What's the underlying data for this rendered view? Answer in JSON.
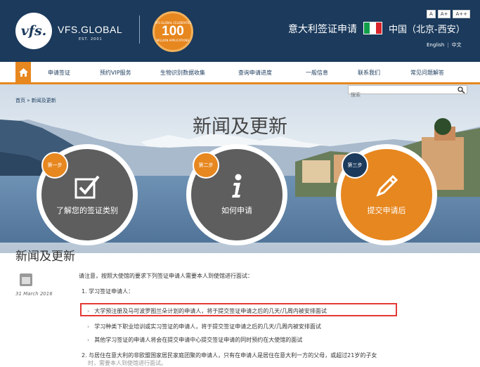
{
  "header": {
    "logo_text": "vfs.",
    "brand": "VFS.GLOBAL",
    "brand_sub": "EST. 2001",
    "badge_top": "VFS GLOBAL CELEBRATES",
    "badge_number": "100",
    "badge_bottom": "MILLION APPLICATIONS",
    "font_sizes": [
      "A",
      "A+",
      "A++"
    ],
    "site_title": "意大利签证申请",
    "flag_colors": [
      "#119e4a",
      "#ffffff",
      "#d9242b"
    ],
    "city": "中国（北京-西安）",
    "lang_en": "English",
    "lang_zh": "中文"
  },
  "nav": {
    "items": [
      "申请签证",
      "预约VIP服务",
      "生物识别数据收集",
      "查询申请进度",
      "一般信息",
      "联系我们",
      "常见问题解答"
    ]
  },
  "hero": {
    "breadcrumb": "首页 » 新闻及更新",
    "search_placeholder": "搜索",
    "title": "新闻及更新",
    "steps": [
      {
        "badge": "第一步",
        "label": "了解您的签证类别",
        "icon": "checkbox-icon"
      },
      {
        "badge": "第二步",
        "label": "如何申请",
        "icon": "info-icon"
      },
      {
        "badge": "第三步",
        "label": "提交申请后",
        "icon": "pencil-icon"
      }
    ]
  },
  "news": {
    "title": "新闻及更新",
    "date": "31 March 2016",
    "notice": "请注意，按照大使馆的要求下列签证申请人需要本人到使馆进行面试：",
    "item1": "1.  学习签证申请人：",
    "subitems": [
      "大学预注册及马可波罗图兰朵计划的申请人，将于提交签证申请之后的几天/几周内被安排面试",
      "学习种类下职业培训或实习签证的申请人，将于提交签证申请之后的几天/几周内被安排面试",
      "其他学习签证的申请人将会在提交申请中心提交签证申请的同时预约在大使馆的面试"
    ],
    "item2": "2.  与居住在意大利的非欧盟国家居民家庭团聚的申请人，只有在申请人是居住在意大利一方的父母，或超过21岁的子女",
    "item2_cont": "时，需要本人到使馆进行面试。"
  },
  "colors": {
    "navy": "#1b3a5c",
    "orange": "#e7871f",
    "grey_circle": "#5e5e5e",
    "highlight": "#e53935"
  }
}
